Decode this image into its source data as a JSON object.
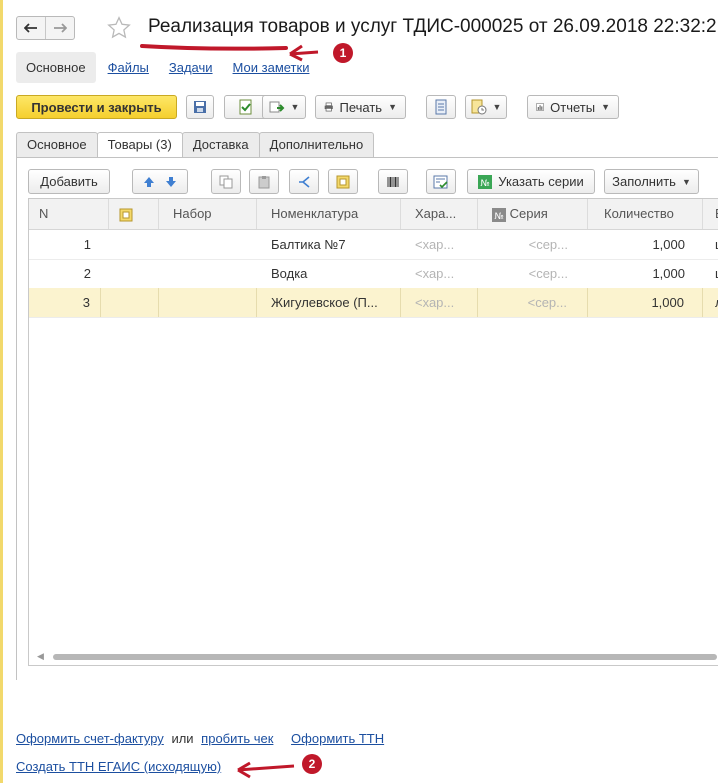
{
  "header": {
    "title": "Реализация товаров и услуг ТДИС-000025 от 26.09.2018 22:32:2",
    "back_icon": "arrow-left-icon",
    "forward_icon": "arrow-right-icon",
    "favorite_icon": "star-icon"
  },
  "subnav": {
    "active": "Основное",
    "links": [
      "Файлы",
      "Задачи",
      "Мои заметки"
    ]
  },
  "toolbar": {
    "post_close": "Провести и закрыть",
    "print": "Печать",
    "reports": "Отчеты"
  },
  "tabs": [
    {
      "label": "Основное",
      "active": false
    },
    {
      "label": "Товары (3)",
      "active": true
    },
    {
      "label": "Доставка",
      "active": false
    },
    {
      "label": "Дополнительно",
      "active": false
    }
  ],
  "table_toolbar": {
    "add": "Добавить",
    "specify_series": "Указать серии",
    "fill": "Заполнить"
  },
  "table": {
    "columns": [
      "N",
      "",
      "Набор",
      "Номенклатура",
      "Хара...",
      "Серия",
      "Количество",
      "Е"
    ],
    "rows": [
      {
        "n": "1",
        "set": "",
        "item": "Балтика №7",
        "char": "<хар...",
        "series": "<сер...",
        "qty": "1,000",
        "unit": "ш"
      },
      {
        "n": "2",
        "set": "",
        "item": "Водка",
        "char": "<хар...",
        "series": "<сер...",
        "qty": "1,000",
        "unit": "ш"
      },
      {
        "n": "3",
        "set": "",
        "item": "Жигулевское (П...",
        "char": "<хар...",
        "series": "<сер...",
        "qty": "1,000",
        "unit": "л"
      }
    ]
  },
  "bottom_links": {
    "invoice": "Оформить счет-фактуру",
    "or": "или",
    "receipt": "пробить чек",
    "ttn": "Оформить ТТН",
    "egais": "Создать ТТН ЕГАИС (исходящую)"
  },
  "annotations": {
    "badge1": "1",
    "badge2": "2",
    "color": "#c0182a"
  },
  "colors": {
    "primary_button": "#f5cf2e",
    "link": "#1c4fa0",
    "selected_row": "#fbf3cf",
    "left_stripe": "#f2d96c"
  }
}
